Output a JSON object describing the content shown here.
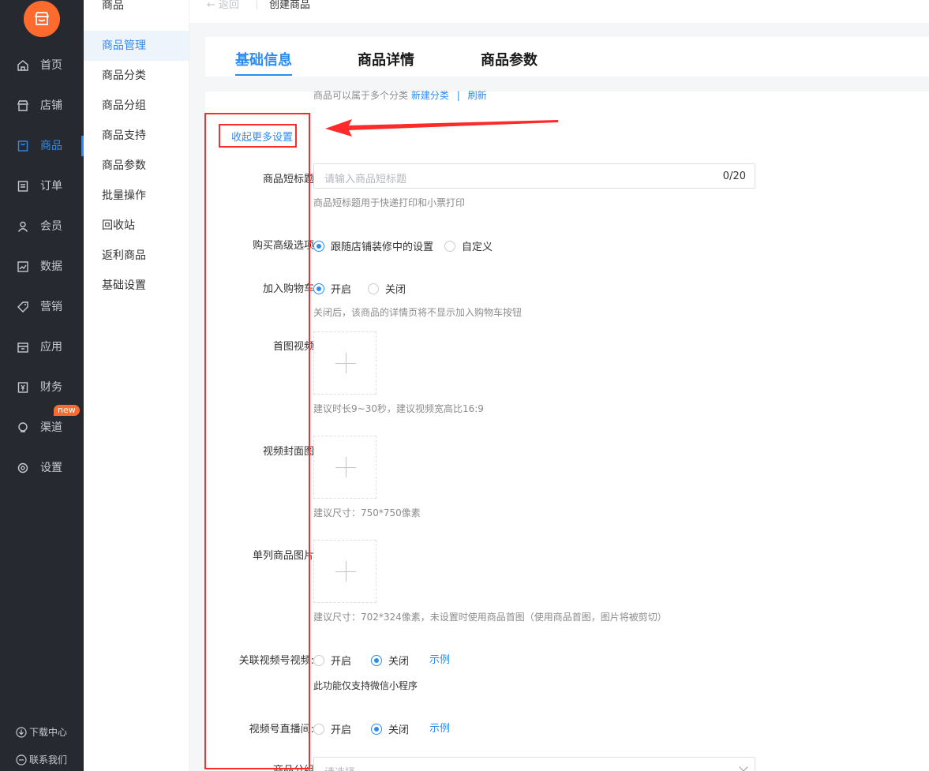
{
  "sidebar": {
    "items": [
      {
        "label": "首页",
        "icon": "home-icon"
      },
      {
        "label": "店铺",
        "icon": "store-icon"
      },
      {
        "label": "商品",
        "icon": "goods-icon"
      },
      {
        "label": "订单",
        "icon": "order-icon"
      },
      {
        "label": "会员",
        "icon": "user-icon"
      },
      {
        "label": "数据",
        "icon": "chart-icon"
      },
      {
        "label": "营销",
        "icon": "tag-icon"
      },
      {
        "label": "应用",
        "icon": "app-icon"
      },
      {
        "label": "财务",
        "icon": "finance-icon"
      },
      {
        "label": "渠道",
        "icon": "channel-icon"
      },
      {
        "label": "设置",
        "icon": "gear-icon"
      }
    ],
    "active_index": 2,
    "badge": "new",
    "download": "下载中心",
    "contact": "联系我们"
  },
  "subnav": {
    "title": "商品",
    "items": [
      "商品管理",
      "商品分类",
      "商品分组",
      "商品支持",
      "商品参数",
      "批量操作",
      "回收站",
      "返利商品",
      "基础设置"
    ],
    "active_index": 0
  },
  "topbar": {
    "back": "返回",
    "title": "创建商品"
  },
  "tabs": [
    "基础信息",
    "商品详情",
    "商品参数"
  ],
  "form": {
    "top_help": "商品可以属于多个分类",
    "new_category": "新建分类",
    "divider": "|",
    "refresh": "刷新",
    "collapse_link": "收起更多设置",
    "short_title": {
      "label": "商品短标题",
      "placeholder": "请输入商品短标题",
      "count": "0/20",
      "help": "商品短标题用于快递打印和小票打印"
    },
    "buy_option": {
      "label": "购买高级选项",
      "opt1": "跟随店铺装修中的设置",
      "opt2": "自定义"
    },
    "cart": {
      "label": "加入购物车",
      "on": "开启",
      "off": "关闭",
      "help": "关闭后，该商品的详情页将不显示加入购物车按钮"
    },
    "video": {
      "label": "首图视频",
      "help": "建议时长9~30秒，建议视频宽高比16:9"
    },
    "cover": {
      "label": "视频封面图",
      "help": "建议尺寸：750*750像素"
    },
    "list_image": {
      "label": "单列商品图片",
      "help": "建议尺寸：702*324像素，未设置时使用商品首图（使用商品首图，图片将被剪切）"
    },
    "channel_video": {
      "label": "关联视频号视频:",
      "on": "开启",
      "off": "关闭",
      "example": "示例",
      "note": "此功能仅支持微信小程序"
    },
    "live": {
      "label": "视频号直播间:",
      "on": "开启",
      "off": "关闭",
      "example": "示例"
    },
    "group": {
      "label": "商品分组",
      "placeholder": "请选择"
    }
  },
  "colors": {
    "accent": "#2d8cf0",
    "sidebar_bg": "#262a30",
    "logo": "#ff6a2f",
    "annotation": "#ff2a2a"
  }
}
